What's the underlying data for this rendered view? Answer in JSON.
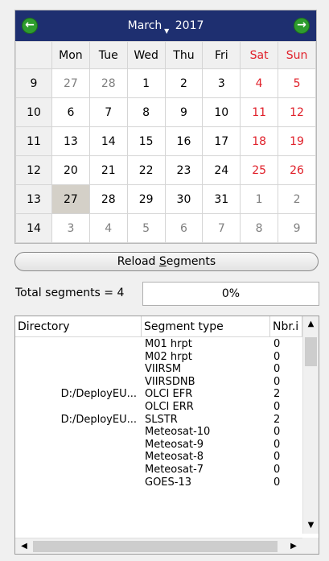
{
  "calendar": {
    "month": "March",
    "year": "2017",
    "prev_icon": "arrow-left-icon",
    "next_icon": "arrow-right-icon",
    "weekdays": [
      "Mon",
      "Tue",
      "Wed",
      "Thu",
      "Fri",
      "Sat",
      "Sun"
    ],
    "weeks": [
      {
        "wk": "9",
        "days": [
          "27",
          "28",
          "1",
          "2",
          "3",
          "4",
          "5"
        ],
        "other": [
          true,
          true,
          false,
          false,
          false,
          false,
          false
        ]
      },
      {
        "wk": "10",
        "days": [
          "6",
          "7",
          "8",
          "9",
          "10",
          "11",
          "12"
        ],
        "other": [
          false,
          false,
          false,
          false,
          false,
          false,
          false
        ]
      },
      {
        "wk": "11",
        "days": [
          "13",
          "14",
          "15",
          "16",
          "17",
          "18",
          "19"
        ],
        "other": [
          false,
          false,
          false,
          false,
          false,
          false,
          false
        ]
      },
      {
        "wk": "12",
        "days": [
          "20",
          "21",
          "22",
          "23",
          "24",
          "25",
          "26"
        ],
        "other": [
          false,
          false,
          false,
          false,
          false,
          false,
          false
        ]
      },
      {
        "wk": "13",
        "days": [
          "27",
          "28",
          "29",
          "30",
          "31",
          "1",
          "2"
        ],
        "other": [
          false,
          false,
          false,
          false,
          false,
          true,
          true
        ]
      },
      {
        "wk": "14",
        "days": [
          "3",
          "4",
          "5",
          "6",
          "7",
          "8",
          "9"
        ],
        "other": [
          true,
          true,
          true,
          true,
          true,
          true,
          true
        ]
      }
    ],
    "selected": "27",
    "colors": {
      "header_bg": "#1e2f70",
      "weekend": "#e0202a",
      "nav_button": "#2e9c2e"
    }
  },
  "reload_button": {
    "label": "Reload Segments"
  },
  "status": {
    "total_label": "Total segments = 4",
    "progress": "0%"
  },
  "segments_table": {
    "columns": [
      "Directory",
      "Segment type",
      "Nbr.i"
    ],
    "rows": [
      {
        "dir": "",
        "type": "M01 hrpt",
        "nbr": "0"
      },
      {
        "dir": "",
        "type": "M02 hrpt",
        "nbr": "0"
      },
      {
        "dir": "",
        "type": "VIIRSM",
        "nbr": "0"
      },
      {
        "dir": "",
        "type": "VIIRSDNB",
        "nbr": "0"
      },
      {
        "dir": "D:/DeployEU...",
        "type": "OLCI EFR",
        "nbr": "2"
      },
      {
        "dir": "",
        "type": "OLCI ERR",
        "nbr": "0"
      },
      {
        "dir": "D:/DeployEU...",
        "type": "SLSTR",
        "nbr": "2"
      },
      {
        "dir": "",
        "type": "Meteosat-10",
        "nbr": "0"
      },
      {
        "dir": "",
        "type": "Meteosat-9",
        "nbr": "0"
      },
      {
        "dir": "",
        "type": "Meteosat-8",
        "nbr": "0"
      },
      {
        "dir": "",
        "type": "Meteosat-7",
        "nbr": "0"
      },
      {
        "dir": "",
        "type": "GOES-13",
        "nbr": "0"
      }
    ]
  }
}
